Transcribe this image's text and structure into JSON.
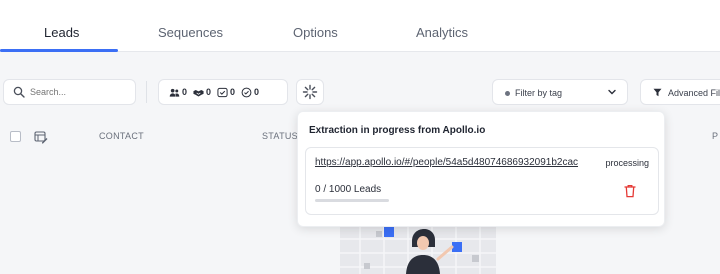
{
  "tabs": [
    {
      "label": "Leads",
      "active": true
    },
    {
      "label": "Sequences",
      "active": false
    },
    {
      "label": "Options",
      "active": false
    },
    {
      "label": "Analytics",
      "active": false
    }
  ],
  "search": {
    "placeholder": "Search...",
    "icon": "search-icon"
  },
  "counters": [
    {
      "icon": "people-icon",
      "value": "0"
    },
    {
      "icon": "handshake-icon",
      "value": "0"
    },
    {
      "icon": "inbox-icon",
      "value": "0"
    },
    {
      "icon": "check-circle-icon",
      "value": "0"
    }
  ],
  "toolbar": {
    "filter_by_tag": "Filter by tag",
    "advanced_filter": "Advanced Filt"
  },
  "table": {
    "columns": {
      "contact": "CONTACT",
      "status": "STATUS",
      "p": "P"
    }
  },
  "popup": {
    "title": "Extraction in progress from Apollo.io",
    "job": {
      "url": "https://app.apollo.io/#/people/54a5d48074686932091b2cac",
      "status": "processing",
      "count_text": "0 / 1000 Leads",
      "progress": 0
    }
  },
  "colors": {
    "accent": "#3b6ff5",
    "danger": "#e53935"
  }
}
